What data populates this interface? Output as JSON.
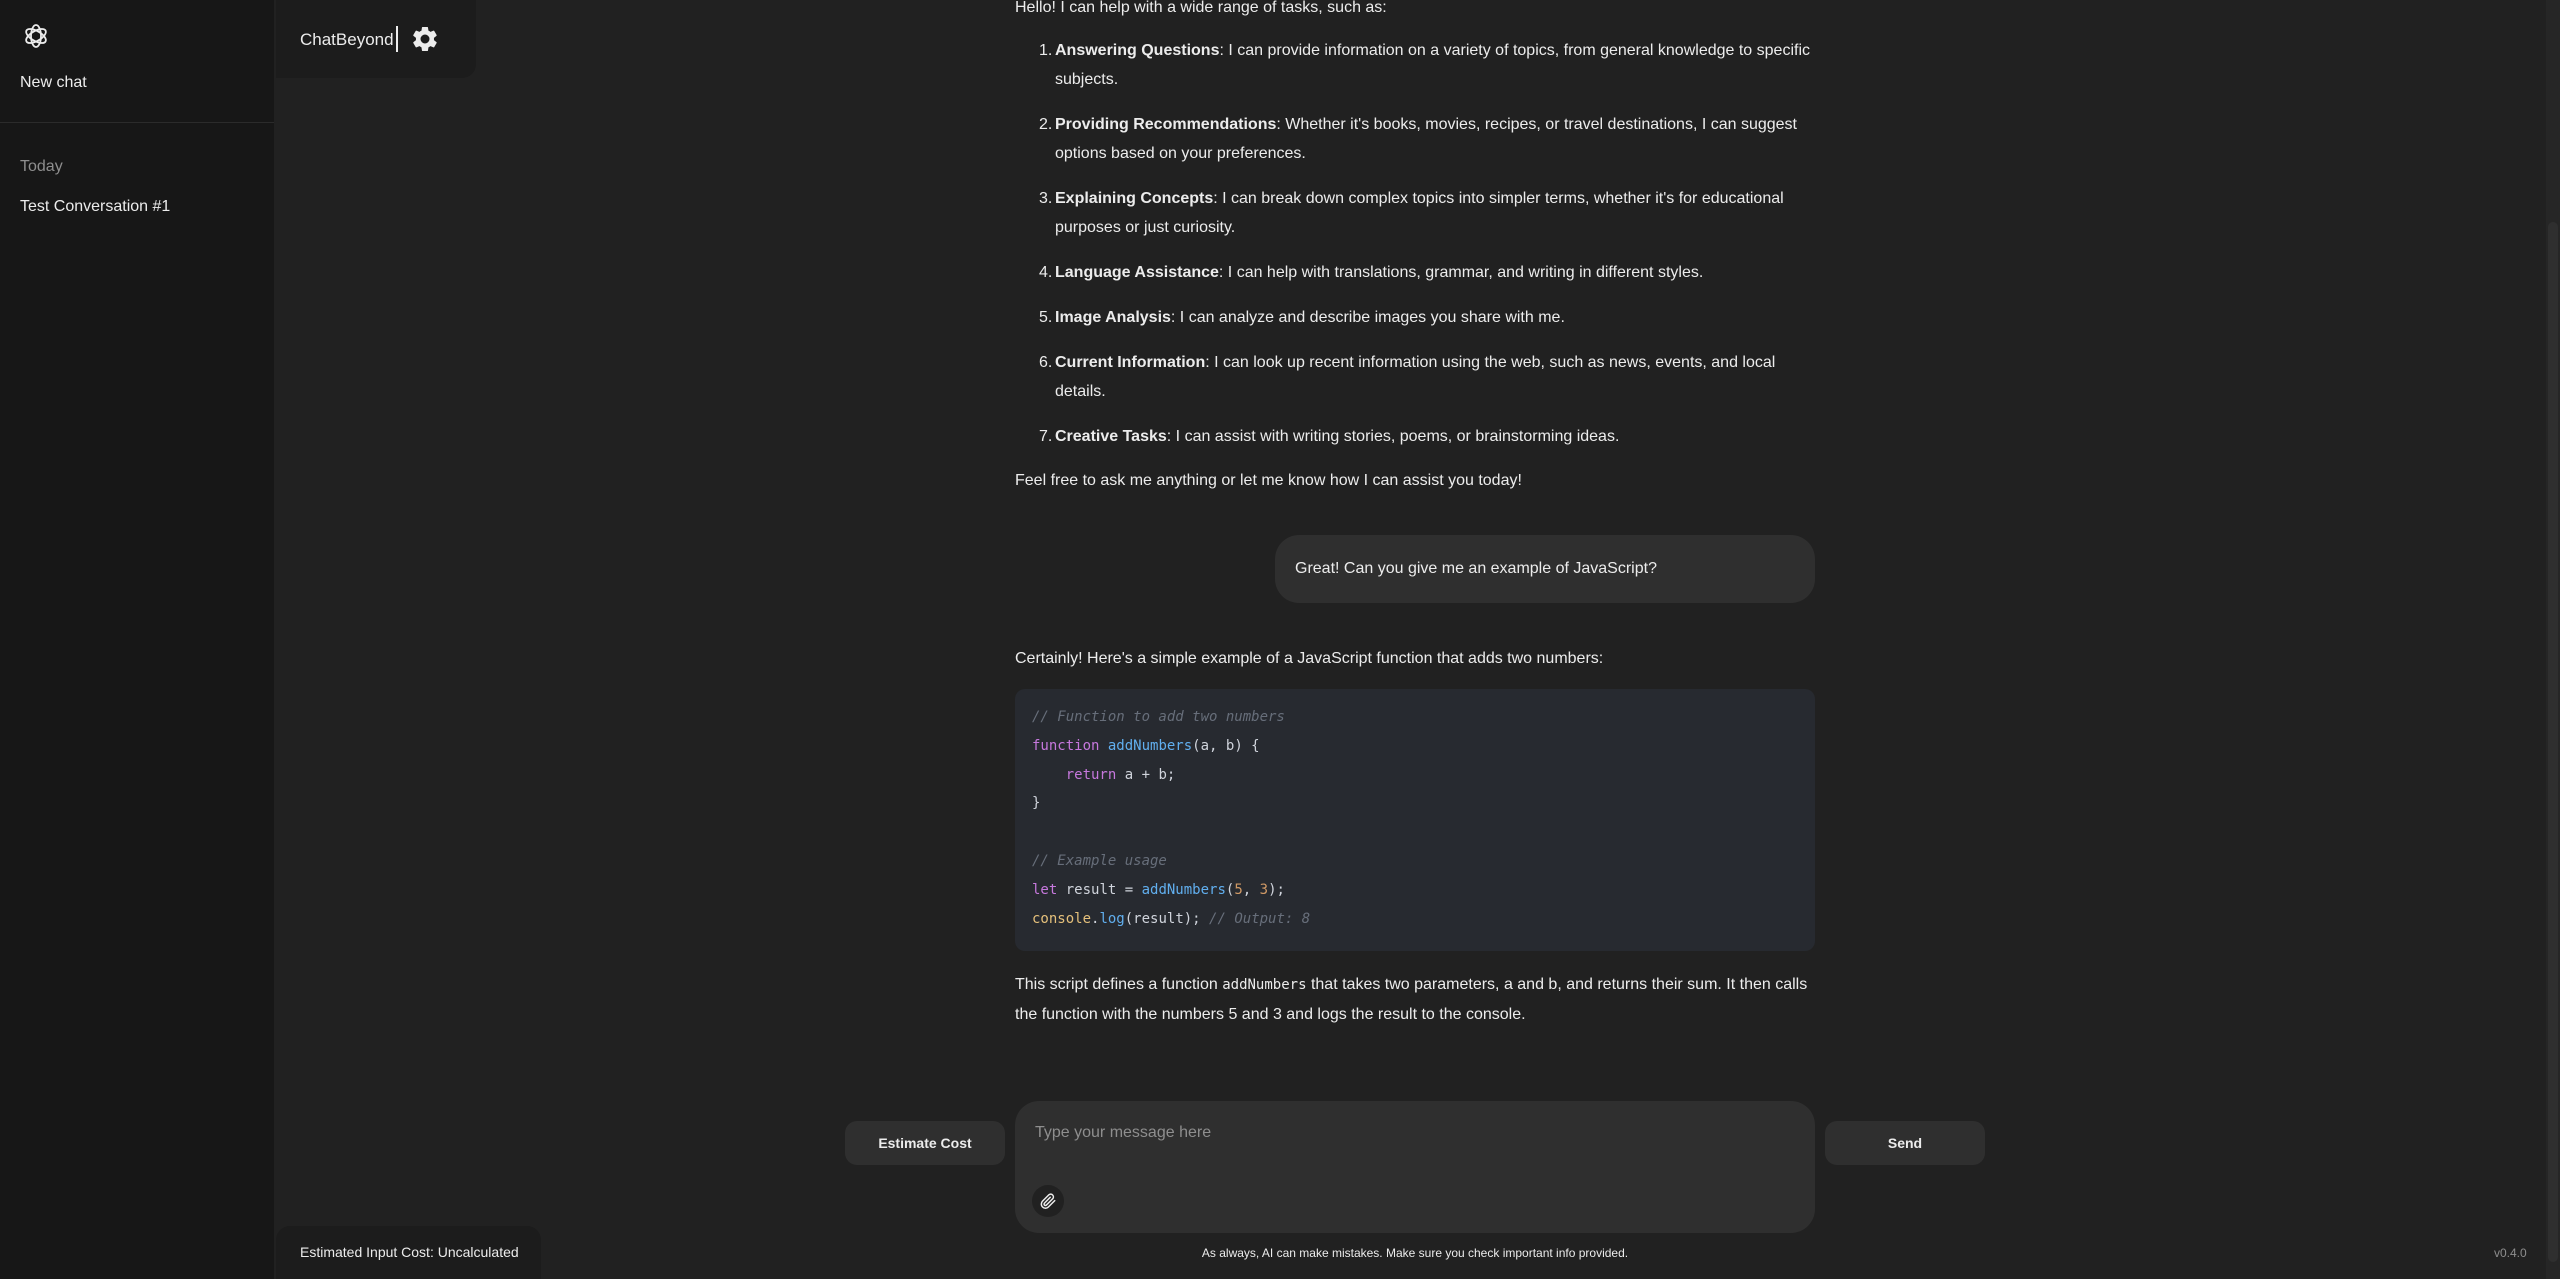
{
  "sidebar": {
    "logo_icon": "openai-knot-icon",
    "new_chat_label": "New chat",
    "section_label": "Today",
    "conversations": [
      "Test Conversation #1"
    ]
  },
  "header": {
    "app_name": "ChatBeyond",
    "settings_icon": "gear-icon"
  },
  "messages": {
    "assistant_1": {
      "intro": "Hello! I can help with a wide range of tasks, such as:",
      "items": [
        {
          "num": "1.",
          "title": "Answering Questions",
          "text": ": I can provide information on a variety of topics, from general knowledge to specific subjects."
        },
        {
          "num": "2.",
          "title": "Providing Recommendations",
          "text": ": Whether it's books, movies, recipes, or travel destinations, I can suggest options based on your preferences."
        },
        {
          "num": "3.",
          "title": "Explaining Concepts",
          "text": ": I can break down complex topics into simpler terms, whether it's for educational purposes or just curiosity."
        },
        {
          "num": "4.",
          "title": "Language Assistance",
          "text": ": I can help with translations, grammar, and writing in different styles."
        },
        {
          "num": "5.",
          "title": "Image Analysis",
          "text": ": I can analyze and describe images you share with me."
        },
        {
          "num": "6.",
          "title": "Current Information",
          "text": ": I can look up recent information using the web, such as news, events, and local details."
        },
        {
          "num": "7.",
          "title": "Creative Tasks",
          "text": ": I can assist with writing stories, poems, or brainstorming ideas."
        }
      ],
      "outro": "Feel free to ask me anything or let me know how I can assist you today!"
    },
    "user_1": "Great! Can you give me an example of JavaScript?",
    "assistant_2": {
      "intro": "Certainly! Here's a simple example of a JavaScript function that adds two numbers:",
      "code": {
        "comment_1": "// Function to add two numbers",
        "kw_function": "function",
        "fn_name": "addNumbers",
        "params": "(a, b) {",
        "kw_return": "return",
        "return_expr": " a + b;",
        "close_brace": "}",
        "comment_2": "// Example usage",
        "kw_let": "let",
        "let_rest": " result = ",
        "call_fn": "addNumbers",
        "call_open": "(",
        "arg_1": "5",
        "comma": ", ",
        "arg_2": "3",
        "call_close": ");",
        "console_obj": "console",
        "dot": ".",
        "log_fn": "log",
        "log_args": "(result); ",
        "comment_3": "// Output: 8"
      },
      "explain_1": "This script defines a function ",
      "explain_code": "addNumbers",
      "explain_2": " that takes two parameters, a and b, and returns their sum. It then calls the function with the numbers 5 and 3 and logs the result to the console."
    }
  },
  "composer": {
    "placeholder": "Type your message here",
    "attach_icon": "paperclip-icon",
    "estimate_label": "Estimate Cost",
    "send_label": "Send",
    "disclaimer": "As always, AI can make mistakes. Make sure you check important info provided."
  },
  "footer": {
    "cost_text": "Estimated Input Cost: Uncalculated",
    "version": "v0.4.0"
  },
  "colors": {
    "background": "#212121",
    "sidebar": "#171717",
    "bubble": "#2f2f2f",
    "code_bg": "#272a30",
    "code_keyword": "#c678dd",
    "code_function": "#61afef",
    "code_number": "#d19a66",
    "code_comment": "#676e7a"
  }
}
